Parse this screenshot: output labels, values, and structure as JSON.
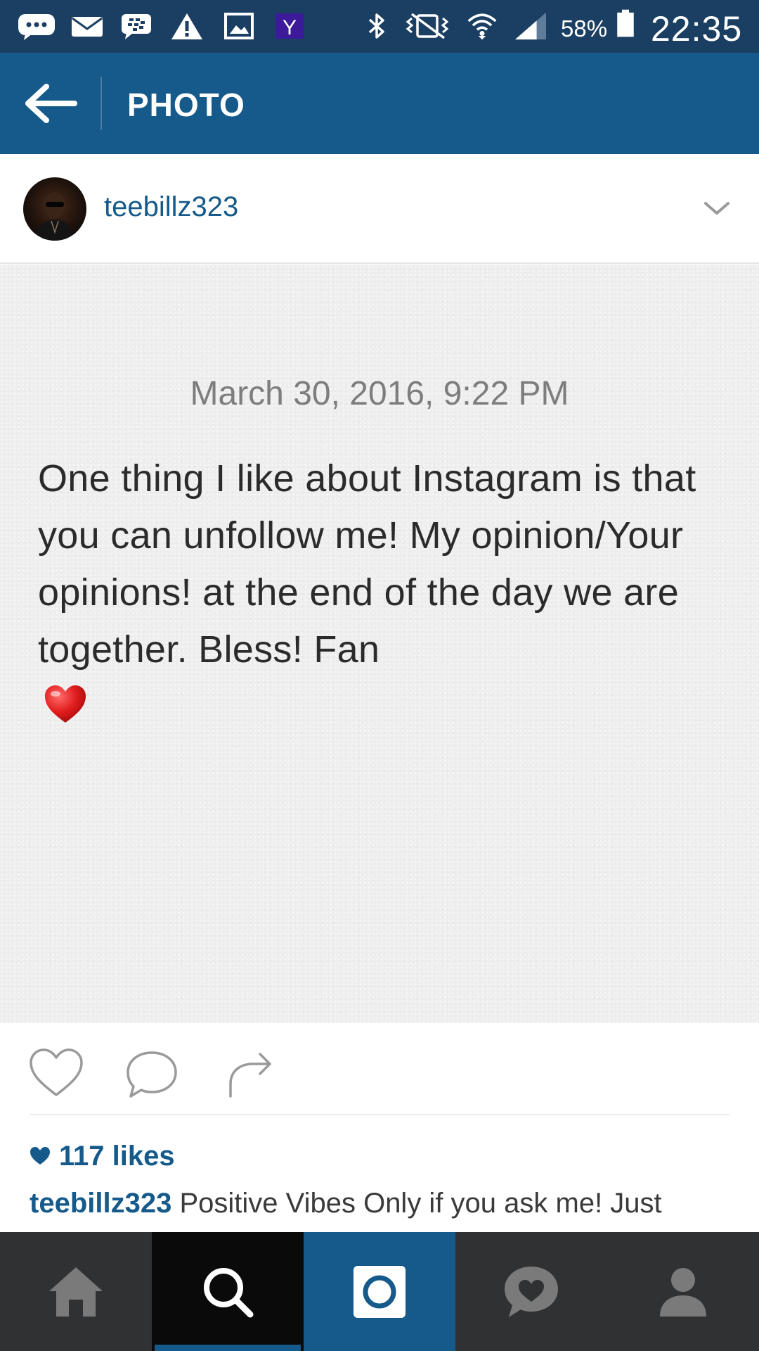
{
  "status_bar": {
    "battery_percent": "58%",
    "time": "22:35",
    "icons": [
      "chat-bubble-icon",
      "mail-icon",
      "bbm-icon",
      "warning-icon",
      "gallery-icon",
      "yahoo-icon",
      "bluetooth-icon",
      "vibrate-icon",
      "wifi-icon",
      "signal-icon",
      "battery-icon"
    ]
  },
  "app_bar": {
    "title": "PHOTO",
    "back_icon": "arrow-left-icon"
  },
  "post": {
    "username": "teebillz323",
    "options_icon": "chevron-down-icon",
    "image": {
      "date": "March 30, 2016, 9:22 PM",
      "text": "One thing I like about Instagram is that you can unfollow me! My opinion/Your opinions! at the end of the day we are together. Bless! Fan",
      "emoji": "red-heart-emoji"
    },
    "actions": {
      "like_icon": "heart-outline-icon",
      "comment_icon": "comment-bubble-icon",
      "share_icon": "share-arrow-icon"
    },
    "likes": "117 likes",
    "caption": {
      "username": "teebillz323",
      "text": "Positive Vibes Only if you ask me! Just"
    }
  },
  "bottom_nav": {
    "items": [
      {
        "name": "home",
        "icon": "home-icon"
      },
      {
        "name": "search",
        "icon": "search-icon",
        "active": true
      },
      {
        "name": "camera",
        "icon": "camera-icon"
      },
      {
        "name": "activity",
        "icon": "activity-heart-icon"
      },
      {
        "name": "profile",
        "icon": "profile-icon"
      }
    ]
  },
  "colors": {
    "status_bar": "#1b3f62",
    "app_bar": "#155a8a",
    "accent_blue": "#155a8a",
    "nav_bg": "#2f3133",
    "note_bg": "#eeeeee"
  }
}
